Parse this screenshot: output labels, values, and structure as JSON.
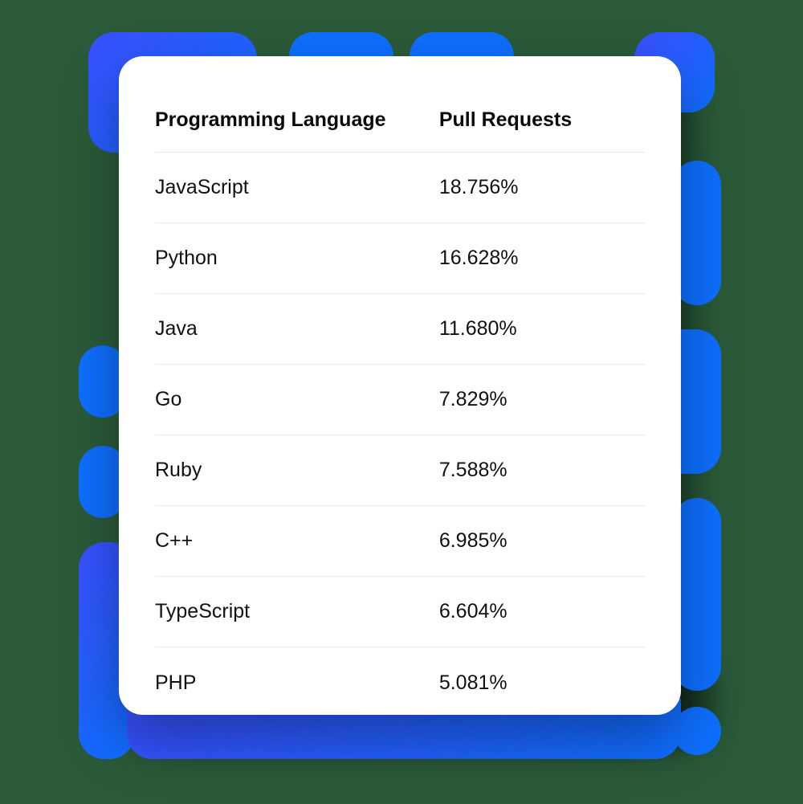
{
  "table": {
    "headers": {
      "language": "Programming Language",
      "pull_requests": "Pull Requests"
    },
    "rows": [
      {
        "language": "JavaScript",
        "pull_requests": "18.756%"
      },
      {
        "language": "Python",
        "pull_requests": "16.628%"
      },
      {
        "language": "Java",
        "pull_requests": "11.680%"
      },
      {
        "language": "Go",
        "pull_requests": "7.829%"
      },
      {
        "language": "Ruby",
        "pull_requests": "7.588%"
      },
      {
        "language": "C++",
        "pull_requests": "6.985%"
      },
      {
        "language": "TypeScript",
        "pull_requests": "6.604%"
      },
      {
        "language": "PHP",
        "pull_requests": "5.081%"
      }
    ]
  }
}
